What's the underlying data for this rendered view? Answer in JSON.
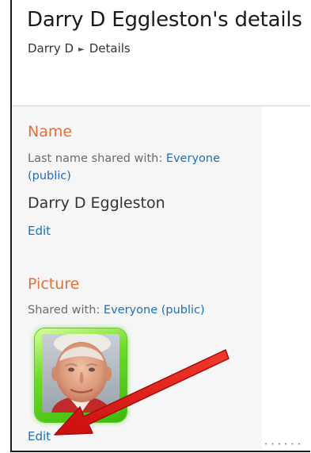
{
  "header": {
    "title": "Darry D Eggleston's details",
    "breadcrumb": {
      "parent": "Darry D",
      "current": "Details",
      "separator": "►"
    }
  },
  "name_section": {
    "heading": "Name",
    "shared_prefix": "Last name shared with: ",
    "shared_link_line1": "Everyone",
    "shared_link_line2": "(public)",
    "value": "Darry D Eggleston",
    "edit_label": "Edit"
  },
  "picture_section": {
    "heading": "Picture",
    "shared_prefix": "Shared with: ",
    "shared_link": "Everyone (public)",
    "edit_label": "Edit"
  },
  "colors": {
    "heading": "#e0703a",
    "link": "#1f6fb5",
    "annotation_arrow": "#e01a1a",
    "avatar_glow": "#55c41a"
  },
  "icons": {
    "profile_photo": "person-photo",
    "annotation": "red-arrow"
  }
}
